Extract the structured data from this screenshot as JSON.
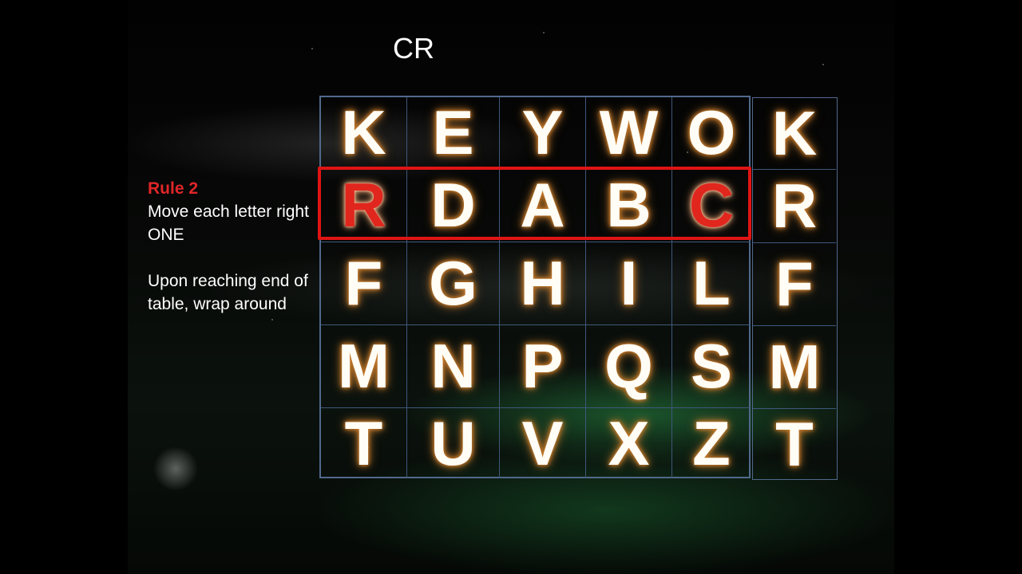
{
  "slide": {
    "title": "CR",
    "rule": {
      "title": "Rule 2",
      "line1": "Move each letter right ONE",
      "line2": "Upon reaching end of table, wrap around"
    }
  },
  "grid": {
    "rows": [
      [
        "K",
        "E",
        "Y",
        "W",
        "O"
      ],
      [
        "R",
        "D",
        "A",
        "B",
        "C"
      ],
      [
        "F",
        "G",
        "H",
        "I",
        "L"
      ],
      [
        "M",
        "N",
        "P",
        "Q",
        "S"
      ],
      [
        "T",
        "U",
        "V",
        "X",
        "Z"
      ]
    ],
    "extra_column": [
      "K",
      "R",
      "F",
      "M",
      "T"
    ],
    "highlighted_row": 1,
    "red_cells": [
      [
        1,
        0
      ],
      [
        1,
        4
      ]
    ]
  },
  "colors": {
    "rule_title": "#e0262a",
    "highlight_border": "#e01414",
    "grid_border": "#51698c",
    "letter_glow": "#c97a2a"
  }
}
